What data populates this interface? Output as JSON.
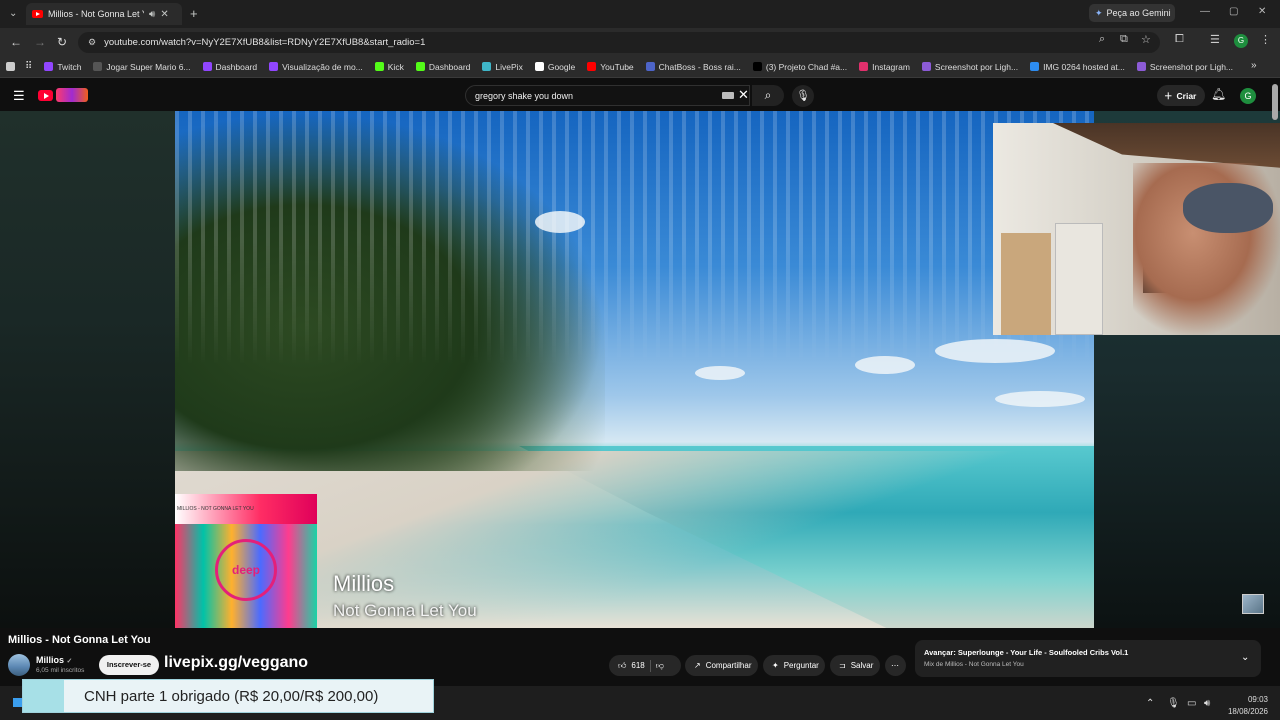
{
  "browser": {
    "tab_title": "Millios - Not Gonna Let You",
    "gemini_label": "Peça ao Gemini",
    "url": "youtube.com/watch?v=NyY2E7XfUB8&list=RDNyY2E7XfUB8&start_radio=1",
    "profile_initial": "G",
    "bookmarks": [
      {
        "label": "Twitch",
        "color": "#9146ff"
      },
      {
        "label": "Jogar Super Mario 6...",
        "color": "#555555"
      },
      {
        "label": "Dashboard",
        "color": "#9146ff"
      },
      {
        "label": "Visualização de mo...",
        "color": "#9146ff"
      },
      {
        "label": "Kick",
        "color": "#53fc18"
      },
      {
        "label": "Dashboard",
        "color": "#53fc18"
      },
      {
        "label": "LivePix",
        "color": "#3fb6c8"
      },
      {
        "label": "Google",
        "color": "#ffffff"
      },
      {
        "label": "YouTube",
        "color": "#ff0000"
      },
      {
        "label": "ChatBoss - Boss rai...",
        "color": "#4d64c8"
      },
      {
        "label": "(3) Projeto Chad #a...",
        "color": "#000000"
      },
      {
        "label": "Instagram",
        "color": "#e1306c"
      },
      {
        "label": "Screenshot por Ligh...",
        "color": "#8c5bd6"
      },
      {
        "label": "IMG 0264 hosted at...",
        "color": "#2d8cf0"
      },
      {
        "label": "Screenshot por Ligh...",
        "color": "#8c5bd6"
      }
    ]
  },
  "youtube": {
    "search_query": "gregory shake you down",
    "create_label": "Criar",
    "user_initial": "G"
  },
  "video": {
    "album_tag": "MILLIOS - NOT GONNA LET YOU",
    "album_logo": "deep",
    "artist_overlay": "Millios",
    "song_overlay": "Not Gonna Let You"
  },
  "watch": {
    "title": "Millios - Not Gonna Let You",
    "channel": "Millios",
    "subscribers": "6,05 mil inscritos",
    "subscribe_label": "Inscrever-se",
    "promo_text": "livepix.gg/veggano",
    "likes": "618",
    "share_label": "Compartilhar",
    "ask_label": "Perguntar",
    "save_label": "Salvar",
    "next_title": "Avançar: Superlounge - Your Life - Soulfooled Cribs Vol.1",
    "next_subtitle": "Mix de Millios - Not Gonna Let You"
  },
  "donation_alert": {
    "text": "CNH parte 1 obrigado (R$ 20,00/R$ 200,00)"
  },
  "taskbar": {
    "time": "09:03",
    "date": "18/08/2026"
  }
}
